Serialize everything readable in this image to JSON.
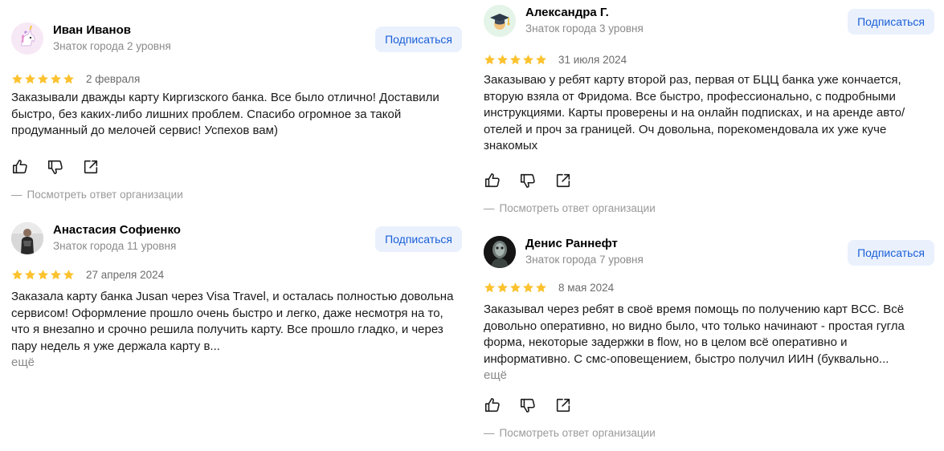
{
  "subscribe_label": "Подписаться",
  "org_reply_label": "Посмотреть ответ организации",
  "org_reply_dash": "—",
  "more_label": "ещё",
  "colors": {
    "star": "#fcc22f",
    "accent": "#1a5fd6",
    "button_bg": "#eaf1fd"
  },
  "reviews": [
    {
      "author": "Иван Иванов",
      "level": "Знаток города 2 уровня",
      "rating": 5,
      "date": "2 февраля",
      "text": "Заказывали дважды карту Киргизского банка. Все было отлично! Доставили быстро, без каких-либо лишних проблем. Спасибо огромное за такой продуманный до мелочей сервис! Успехов вам)",
      "avatar_icon": "unicorn-icon"
    },
    {
      "author": "Анастасия Софиенко",
      "level": "Знаток города 11 уровня",
      "rating": 5,
      "date": "27 апреля 2024",
      "text": "Заказала карту банка Jusan через Visa Travel, и осталась полностью довольна сервисом! Оформление прошло очень быстро и легко, даже несмотря на то, что я внезапно и срочно решила получить карту. Все прошло гладко, и через пару недель я уже держала карту в...",
      "avatar_icon": "user-photo"
    },
    {
      "author": "Александра Г.",
      "level": "Знаток города 3 уровня",
      "rating": 5,
      "date": "31 июля 2024",
      "text": "Заказываю у ребят карту второй раз, первая от БЦЦ банка уже кончается, вторую взяла от Фридома. Все быстро, профессионально, с подробными инструкциями. Карты проверены и на онлайн подписках, и на аренде авто/отелей и проч за границей. Оч довольна, порекомендовала их уже куче знакомых",
      "avatar_icon": "graduation-cap-icon"
    },
    {
      "author": "Денис Раннефт",
      "level": "Знаток города 7 уровня",
      "rating": 5,
      "date": "8 мая 2024",
      "text": "Заказывал через ребят в своё время помощь по получению карт BCC. Всё довольно оперативно, но видно было, что только начинают - простая гугла форма, некоторые задержки в flow, но в целом всё оперативно и информативно. С смс-оповещением, быстро получил ИИН (буквально...",
      "avatar_icon": "user-photo"
    }
  ]
}
